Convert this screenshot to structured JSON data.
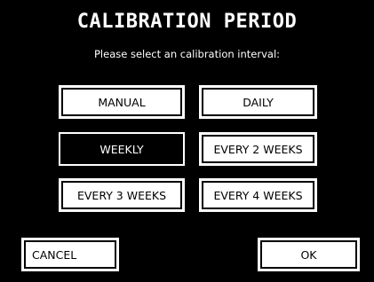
{
  "dialog": {
    "title": "CALIBRATION PERIOD",
    "subtitle": "Please select an calibration interval:",
    "options": [
      {
        "label": "MANUAL",
        "selected": false
      },
      {
        "label": "DAILY",
        "selected": false
      },
      {
        "label": "WEEKLY",
        "selected": true
      },
      {
        "label": "EVERY 2 WEEKS",
        "selected": false
      },
      {
        "label": "EVERY 3 WEEKS",
        "selected": false
      },
      {
        "label": "EVERY 4 WEEKS",
        "selected": false
      }
    ],
    "cancel_label": "CANCEL",
    "ok_label": "OK"
  },
  "colors": {
    "background": "#000000",
    "button_fill": "#ffffff",
    "button_text": "#000000",
    "selected_fill": "#000000",
    "selected_text": "#ffffff"
  }
}
